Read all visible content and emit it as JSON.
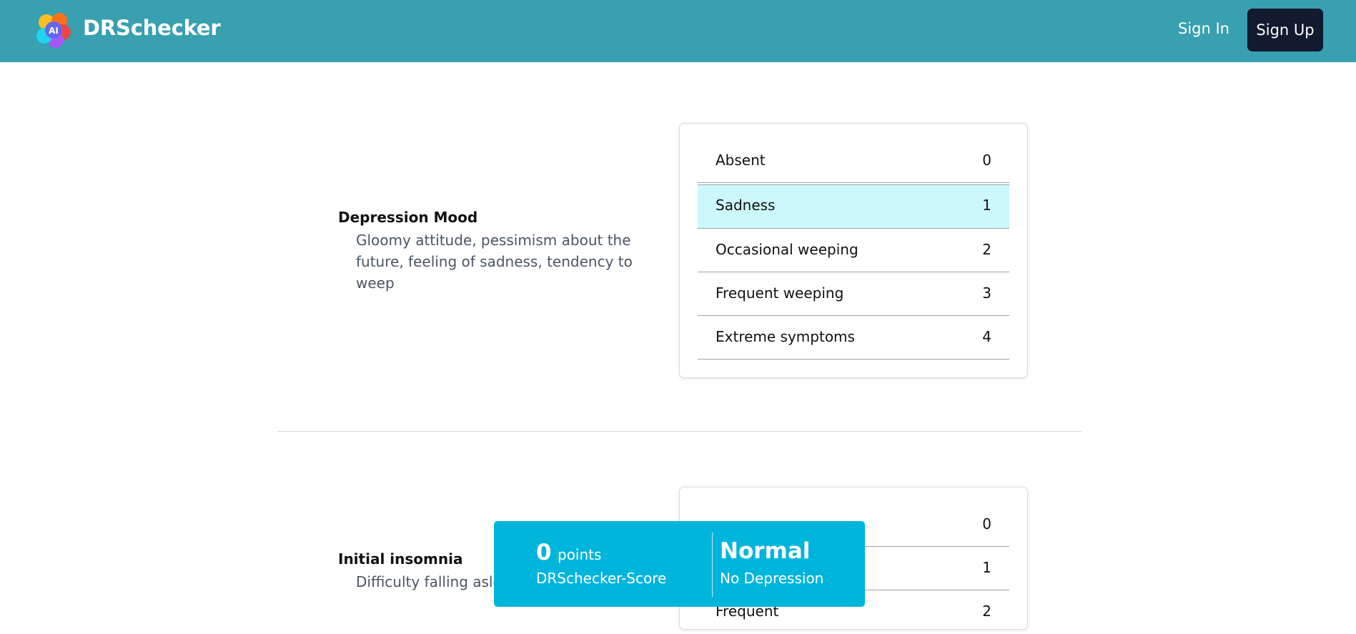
{
  "header": {
    "brand": "DRSchecker",
    "logo_badge": "AI",
    "signin_label": "Sign In",
    "signup_label": "Sign Up",
    "bg_color": "#38a0b0"
  },
  "questions": [
    {
      "title": "Depression Mood",
      "description": "Gloomy attitude, pessimism about the future, feeling of sadness, tendency to weep",
      "desc_lines": [
        "Gloomy attitude, pessimism about the",
        "future, feeling of sadness, tendency to",
        "weep"
      ],
      "options": [
        {
          "label": "Absent",
          "value": "0"
        },
        {
          "label": "Sadness",
          "value": "1",
          "selected": true
        },
        {
          "label": "Occasional weeping",
          "value": "2"
        },
        {
          "label": "Frequent weeping",
          "value": "3"
        },
        {
          "label": "Extreme symptoms",
          "value": "4"
        }
      ]
    },
    {
      "title": "Initial insomnia",
      "description_visible": "Difficulty falling asle",
      "options": [
        {
          "label": "",
          "value": "0"
        },
        {
          "label": "",
          "value": "1"
        },
        {
          "label": "Frequent",
          "value": "2"
        }
      ]
    }
  ],
  "score_banner": {
    "points": "0",
    "points_unit": "points",
    "score_label": "DRSchecker-Score",
    "status": "Normal",
    "status_desc": "No Depression",
    "bg_color": "#00b5dc"
  }
}
